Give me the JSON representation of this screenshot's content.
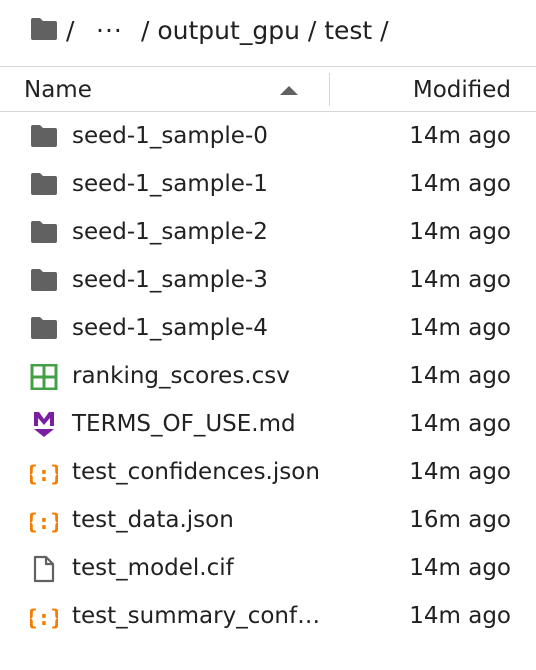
{
  "breadcrumb": {
    "root_sep": "/",
    "ellipsis": "···",
    "path": "/ output_gpu / test /"
  },
  "header": {
    "name": "Name",
    "modified": "Modified"
  },
  "files": [
    {
      "name": "seed-1_sample-0",
      "modified": "14m ago",
      "icon": "folder-icon"
    },
    {
      "name": "seed-1_sample-1",
      "modified": "14m ago",
      "icon": "folder-icon"
    },
    {
      "name": "seed-1_sample-2",
      "modified": "14m ago",
      "icon": "folder-icon"
    },
    {
      "name": "seed-1_sample-3",
      "modified": "14m ago",
      "icon": "folder-icon"
    },
    {
      "name": "seed-1_sample-4",
      "modified": "14m ago",
      "icon": "folder-icon"
    },
    {
      "name": "ranking_scores.csv",
      "modified": "14m ago",
      "icon": "spreadsheet-icon"
    },
    {
      "name": "TERMS_OF_USE.md",
      "modified": "14m ago",
      "icon": "markdown-icon"
    },
    {
      "name": "test_confidences.json",
      "modified": "14m ago",
      "icon": "json-icon"
    },
    {
      "name": "test_data.json",
      "modified": "16m ago",
      "icon": "json-icon"
    },
    {
      "name": "test_model.cif",
      "modified": "14m ago",
      "icon": "file-icon"
    },
    {
      "name": "test_summary_conf…",
      "modified": "14m ago",
      "icon": "json-icon"
    }
  ],
  "colors": {
    "folder": "#616161",
    "csv": "#43a047",
    "markdown": "#7b1fa2",
    "json": "#f57c00",
    "file": "#616161"
  }
}
